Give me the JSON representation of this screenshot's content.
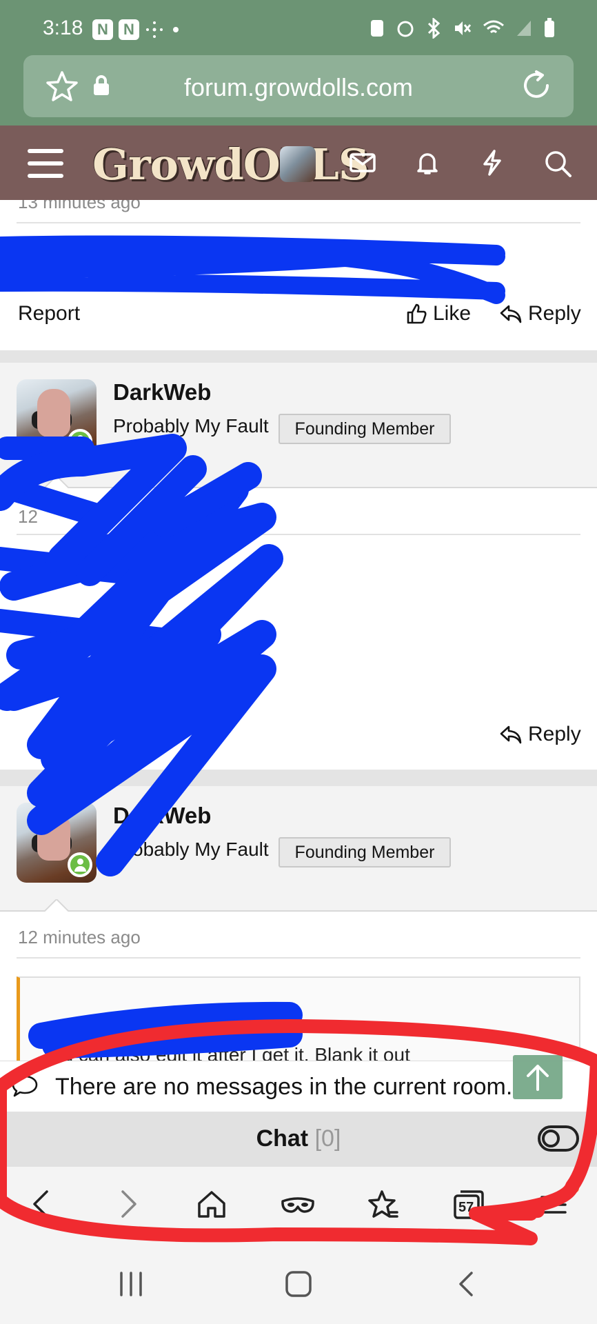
{
  "status_bar": {
    "time": "3:18"
  },
  "browser": {
    "url": "forum.growdolls.com",
    "tabs_count": "57"
  },
  "site": {
    "logo": "GrowdOLLS"
  },
  "posts": [
    {
      "timestamp": "13 minutes ago",
      "actions": {
        "report": "Report",
        "like": "Like",
        "reply": "Reply"
      }
    },
    {
      "username": "DarkWeb",
      "user_title": "Probably My Fault",
      "badge": "Founding Member",
      "timestamp": "12",
      "actions": {
        "reply": "Reply"
      }
    },
    {
      "username": "DarkWeb",
      "user_title": "Probably My Fault",
      "badge": "Founding Member",
      "timestamp": "12 minutes ago",
      "quote_text": "ou can also edit it after I get it. Blank it out"
    }
  ],
  "chat": {
    "preview_text": "There are no messages in the current room.",
    "label": "Chat",
    "count": "[0]"
  },
  "colors": {
    "browser_green": "#6c9474",
    "nav_brown": "#7a5c5a",
    "online_green": "#6cbd45",
    "quote_accent": "#e99a1c",
    "scribble_blue": "#0a36f2",
    "annotation_red": "#f02b30"
  }
}
